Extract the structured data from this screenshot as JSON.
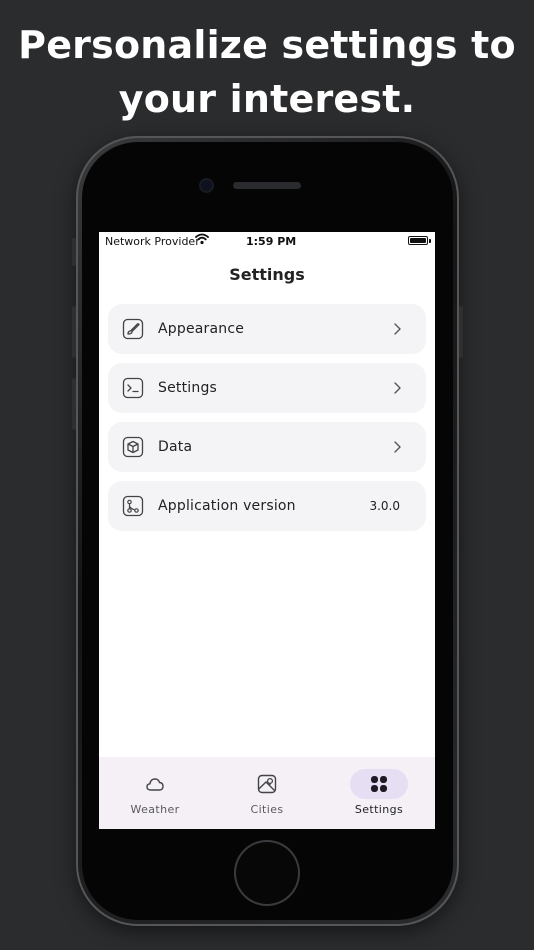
{
  "headline": "Personalize settings to your interest.",
  "status_bar": {
    "carrier": "Network Provider",
    "time": "1:59 PM"
  },
  "screen": {
    "title": "Settings",
    "rows": [
      {
        "label": "Appearance",
        "icon": "brush-icon",
        "trailing": "chevron"
      },
      {
        "label": "Settings",
        "icon": "terminal-icon",
        "trailing": "chevron"
      },
      {
        "label": "Data",
        "icon": "cube-icon",
        "trailing": "chevron"
      },
      {
        "label": "Application version",
        "icon": "git-branch-icon",
        "value": "3.0.0"
      }
    ]
  },
  "tab_bar": {
    "tabs": [
      {
        "label": "Weather",
        "icon": "cloud-icon",
        "active": false
      },
      {
        "label": "Cities",
        "icon": "map-icon",
        "active": false
      },
      {
        "label": "Settings",
        "icon": "grid-icon",
        "active": true
      }
    ]
  },
  "colors": {
    "background": "#2b2c2e",
    "row_background": "#f4f3f5",
    "tab_bar_background": "#f4f0f6",
    "active_tab_pill": "#e6def3"
  }
}
